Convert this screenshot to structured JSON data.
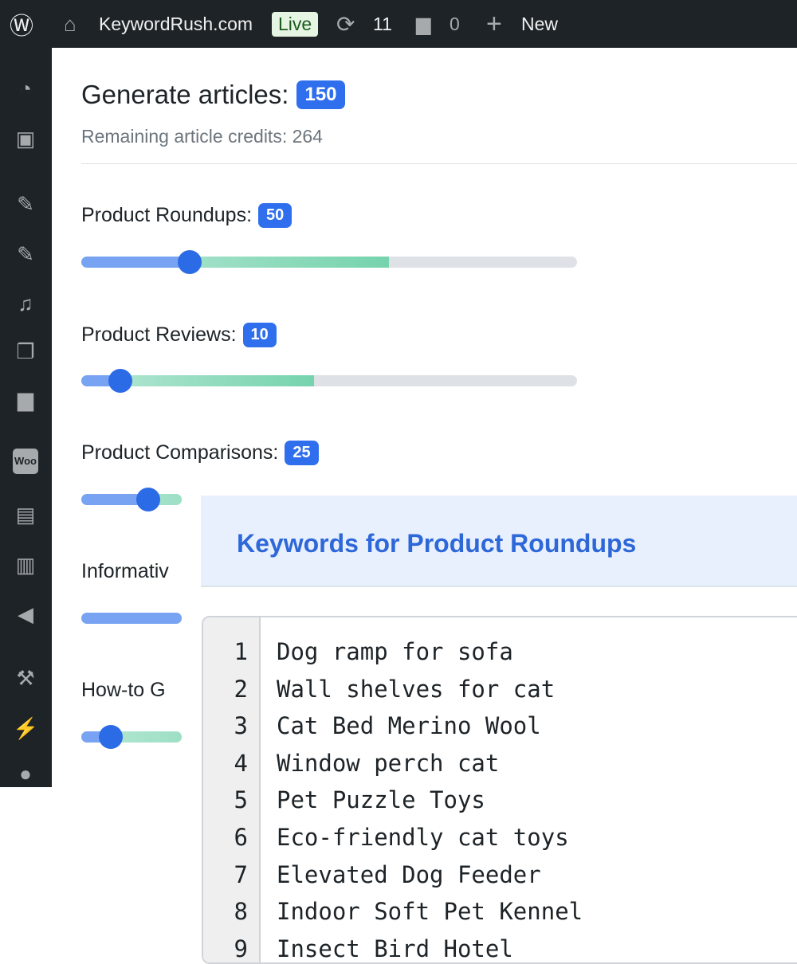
{
  "topbar": {
    "site": "KeywordRush.com",
    "status": "Live",
    "updates": "11",
    "comments": "0",
    "new": "New"
  },
  "header": {
    "title": "Generate articles:",
    "total": "150",
    "credits": "Remaining article credits: 264"
  },
  "sliders": [
    {
      "label": "Product Roundups:",
      "value": "50",
      "fraction": 0.2,
      "green": 0.62
    },
    {
      "label": "Product Reviews:",
      "value": "10",
      "fraction": 0.06,
      "green": 0.47
    },
    {
      "label": "Product Comparisons:",
      "value": "25",
      "fraction": 0.115,
      "green": 0.5
    },
    {
      "label": "Informativ",
      "value": "",
      "fraction": null,
      "green": 0
    },
    {
      "label": "How-to G",
      "value": "",
      "fraction": 0.04,
      "green": 0.5
    }
  ],
  "panel": {
    "title": "Keywords for Product Roundups",
    "lines": [
      "Dog ramp for sofa",
      "Wall shelves for cat",
      "Cat Bed Merino Wool",
      "Window perch cat",
      "Pet Puzzle Toys",
      "Eco-friendly cat toys",
      "Elevated Dog Feeder",
      "Indoor Soft Pet Kennel",
      "Insect Bird Hotel"
    ]
  }
}
